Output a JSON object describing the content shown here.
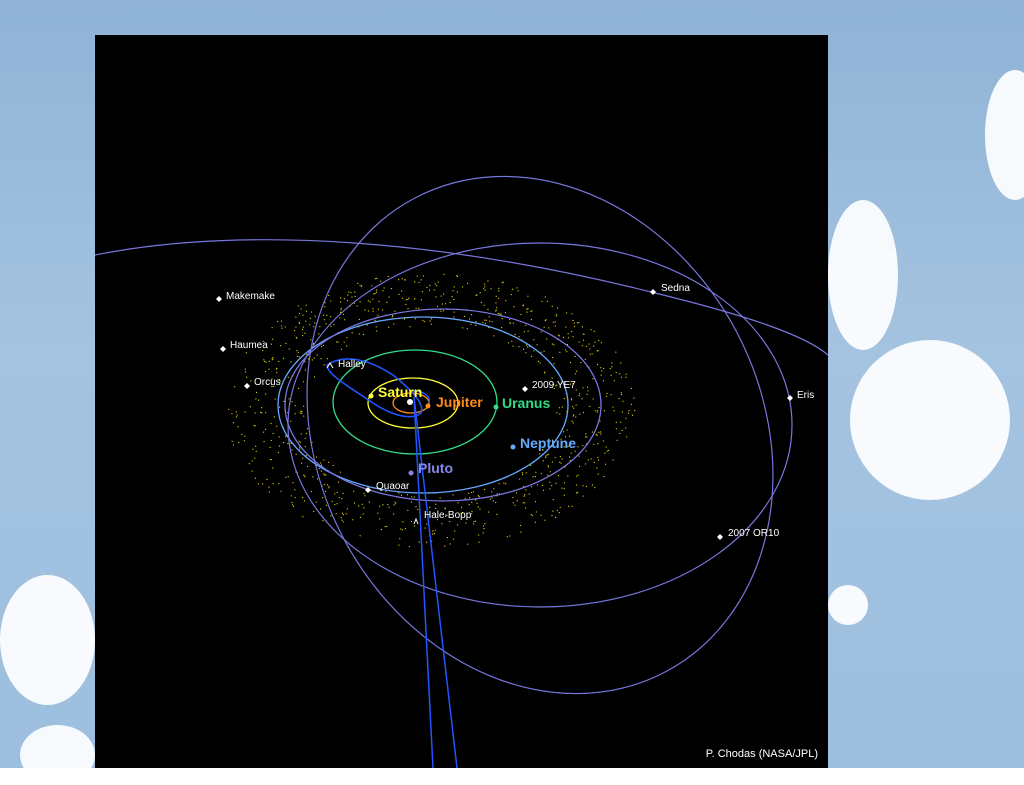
{
  "bodies": {
    "makemake": "Makemake",
    "haumea": "Haumea",
    "orcus": "Orcus",
    "halley": "Halley",
    "saturn": "Saturn",
    "jupiter": "Jupiter",
    "uranus": "Uranus",
    "neptune": "Neptune",
    "pluto": "Pluto",
    "quaoar": "Quaoar",
    "hale_bopp": "Hale-Bopp",
    "sedna": "Sedna",
    "eris": "Eris",
    "ye7": "2009 YE7",
    "or10": "2007 OR10"
  },
  "credit": "P. Chodas (NASA/JPL)",
  "colors": {
    "jupiter": "#ff8c1a",
    "saturn": "#ffff33",
    "uranus": "#33dd88",
    "neptune": "#66aaff",
    "pluto": "#8888ee",
    "orbit": "#7777dd",
    "comet": "#2255ff",
    "kuiper": "#e6d400"
  }
}
